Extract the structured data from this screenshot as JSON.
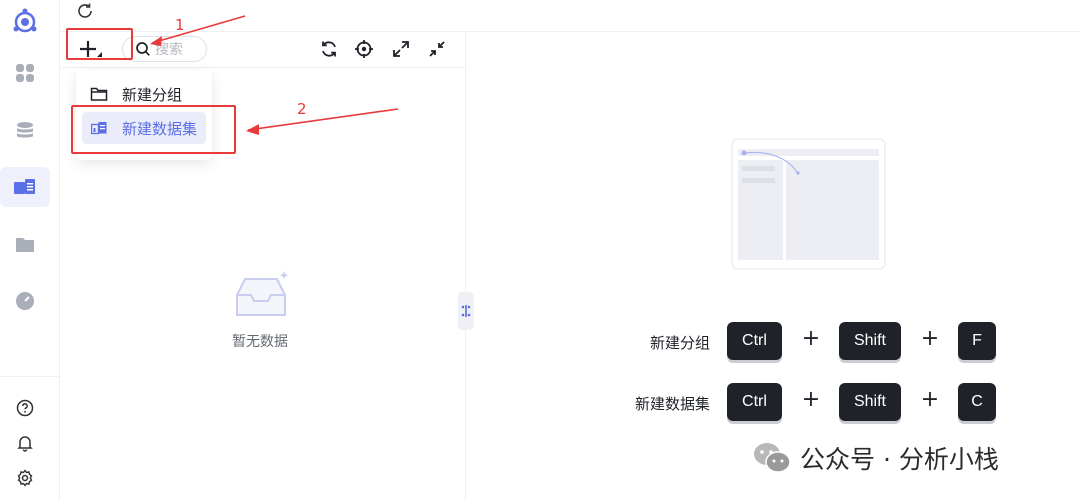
{
  "toolbar": {
    "refresh_icon": "refresh-icon"
  },
  "tree_panel": {
    "search": {
      "placeholder": "搜索"
    },
    "empty_text": "暂无数据"
  },
  "dropdown": {
    "items": [
      {
        "label": "新建分组",
        "icon": "folder-icon"
      },
      {
        "label": "新建数据集",
        "icon": "dataset-icon"
      }
    ]
  },
  "annotations": {
    "label_1": "1",
    "label_2": "2",
    "color": "#e83a3a"
  },
  "shortcuts": [
    {
      "label": "新建分组",
      "keys": [
        "Ctrl",
        "Shift",
        "F"
      ]
    },
    {
      "label": "新建数据集",
      "keys": [
        "Ctrl",
        "Shift",
        "C"
      ]
    }
  ],
  "shortcut_joiner": "+",
  "watermark": {
    "text": "公众号 · 分析小栈"
  },
  "colors": {
    "accent": "#5b6fe6",
    "key_bg": "#1f2329"
  }
}
